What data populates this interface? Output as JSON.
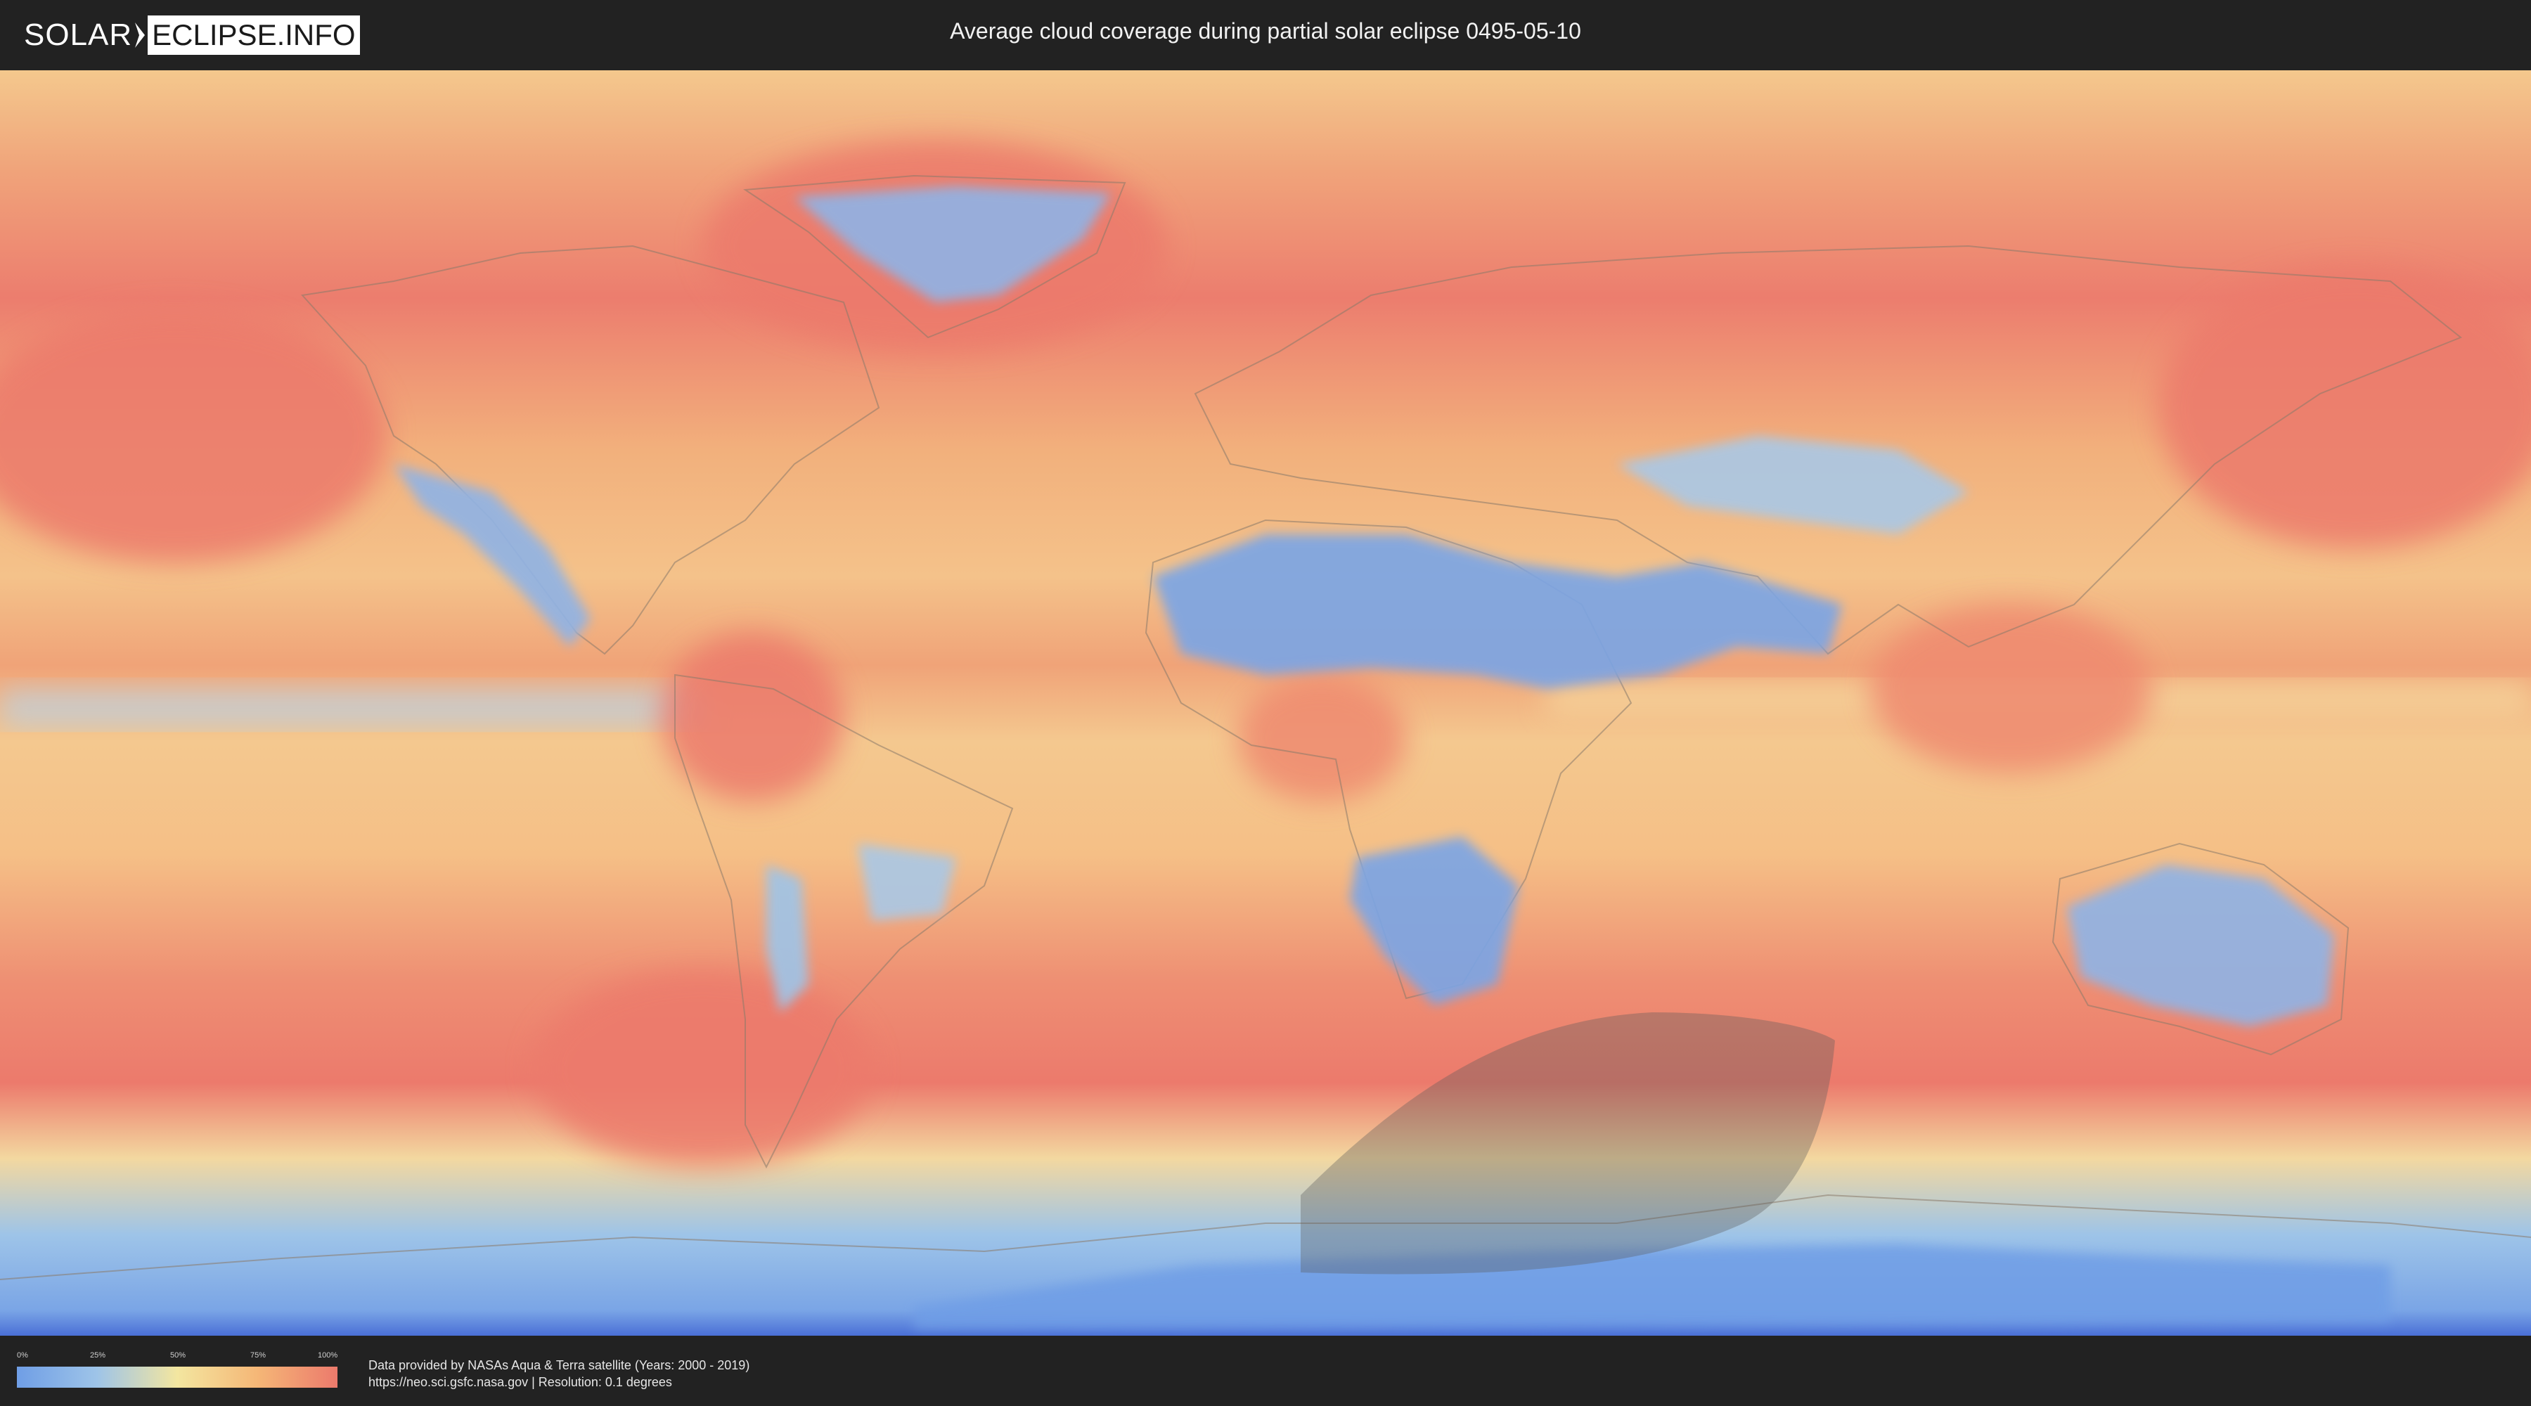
{
  "header": {
    "logo_left": "SOLAR",
    "logo_right": "ECLIPSE.INFO",
    "title": "Average cloud coverage during partial solar eclipse 0495-05-10"
  },
  "map": {
    "projection": "equirectangular",
    "layer": "average cloud coverage",
    "colors": {
      "clear": "#6f9ee6",
      "low": "#9ec4e8",
      "mid": "#f3e6a0",
      "high": "#f5b777",
      "overcast": "#ec7a6c",
      "eclipse_shadow": "#5a5a5a",
      "antarctic_edge": "#4a6fd6"
    }
  },
  "legend": {
    "ticks": [
      "0%",
      "25%",
      "50%",
      "75%",
      "100%"
    ]
  },
  "footer": {
    "credit_line1": "Data provided by NASAs Aqua & Terra satellite (Years: 2000 - 2019)",
    "credit_line2": "https://neo.sci.gsfc.nasa.gov | Resolution: 0.1 degrees"
  }
}
